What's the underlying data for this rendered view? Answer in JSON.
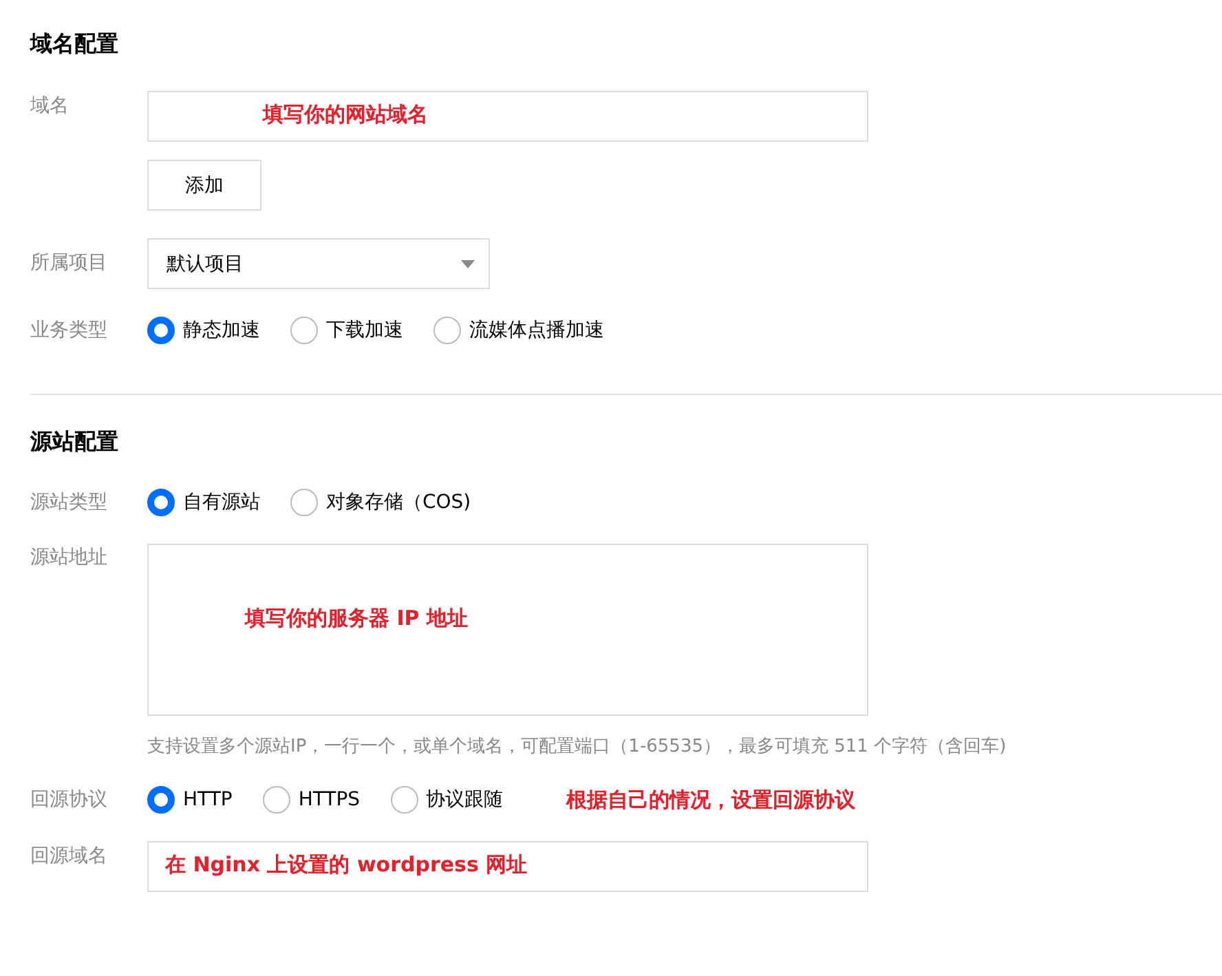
{
  "sections": [
    {
      "title": "域名配置",
      "rows": [
        {
          "kind": "input",
          "label": "域名",
          "annotation": "填写你的网站域名",
          "button": "添加"
        },
        {
          "kind": "select",
          "label": "所属项目",
          "value": "默认项目"
        },
        {
          "kind": "radio",
          "label": "业务类型",
          "options": [
            {
              "label": "静态加速",
              "selected": true
            },
            {
              "label": "下载加速",
              "selected": false
            },
            {
              "label": "流媒体点播加速",
              "selected": false
            }
          ]
        }
      ]
    },
    {
      "title": "源站配置",
      "rows": [
        {
          "kind": "radio",
          "label": "源站类型",
          "options": [
            {
              "label": "自有源站",
              "selected": true
            },
            {
              "label": "对象存储（COS)",
              "selected": false
            }
          ]
        },
        {
          "kind": "textarea",
          "label": "源站地址",
          "annotation": "填写你的服务器 IP 地址",
          "hint": "支持设置多个源站IP，一行一个，或单个域名，可配置端口（1-65535），最多可填充 511 个字符（含回车)"
        },
        {
          "kind": "radio",
          "label": "回源协议",
          "options": [
            {
              "label": "HTTP",
              "selected": true
            },
            {
              "label": "HTTPS",
              "selected": false
            },
            {
              "label": "协议跟随",
              "selected": false
            }
          ],
          "annotation": "根据自己的情况，设置回源协议"
        },
        {
          "kind": "input",
          "label": "回源域名",
          "annotation": "在 Nginx 上设置的 wordpress 网址"
        }
      ]
    }
  ]
}
